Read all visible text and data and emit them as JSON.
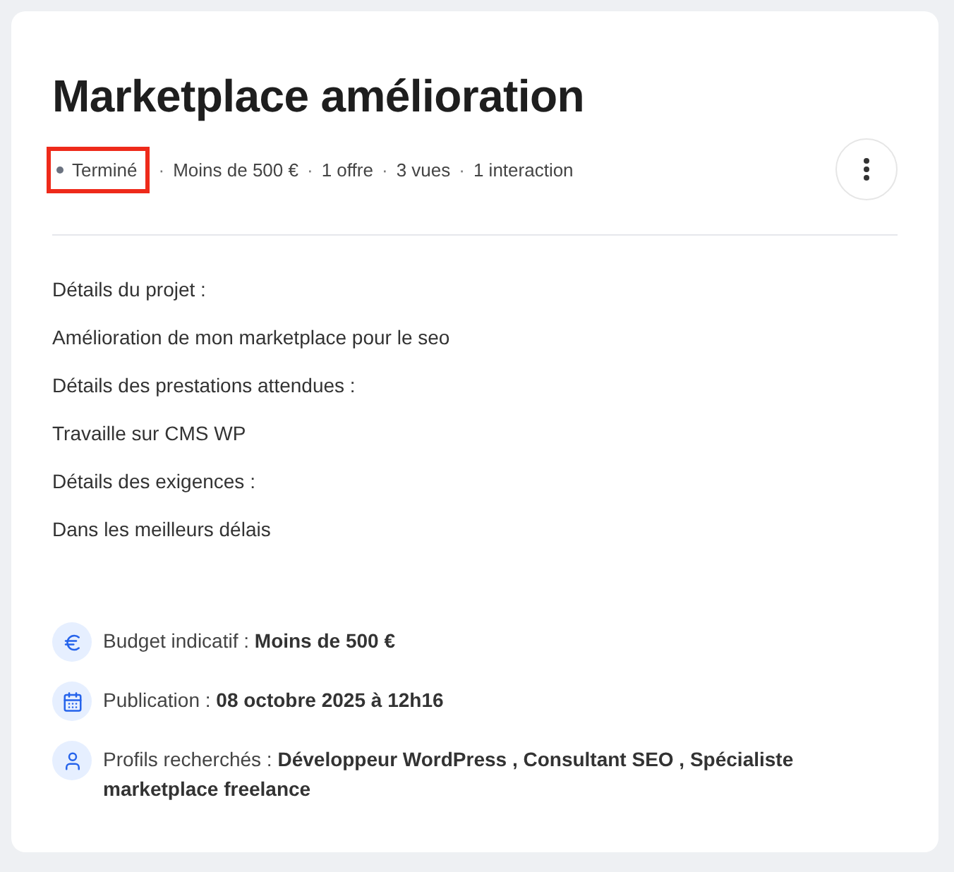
{
  "title": "Marketplace amélioration",
  "meta": [
    {
      "kind": "status",
      "text": "Terminé",
      "color": "#6b7280",
      "highlighted": true
    },
    {
      "kind": "separator",
      "text": "·"
    },
    {
      "kind": "text",
      "text": "Moins de 500 €"
    },
    {
      "kind": "separator",
      "text": "·"
    },
    {
      "kind": "text",
      "text": "1 offre"
    },
    {
      "kind": "separator",
      "text": "·"
    },
    {
      "kind": "text",
      "text": "3 vues"
    },
    {
      "kind": "separator",
      "text": "·"
    },
    {
      "kind": "text",
      "text": "1 interaction"
    }
  ],
  "details": [
    "Détails du projet :",
    "Amélioration de mon marketplace pour le seo",
    "Détails des prestations attendues :",
    "Travaille sur CMS WP",
    "Détails des exigences :",
    "Dans les meilleurs délais"
  ],
  "info": [
    {
      "kind": "euro",
      "text": "Budget indicatif : **Moins de 500 €**"
    },
    {
      "kind": "calendar",
      "text": "Publication : **08 octobre 2025 à 12h16**"
    },
    {
      "kind": "person",
      "text": "Profils recherchés : **Développeur WordPress , Consultant SEO , Spécialiste marketplace freelance**"
    }
  ]
}
